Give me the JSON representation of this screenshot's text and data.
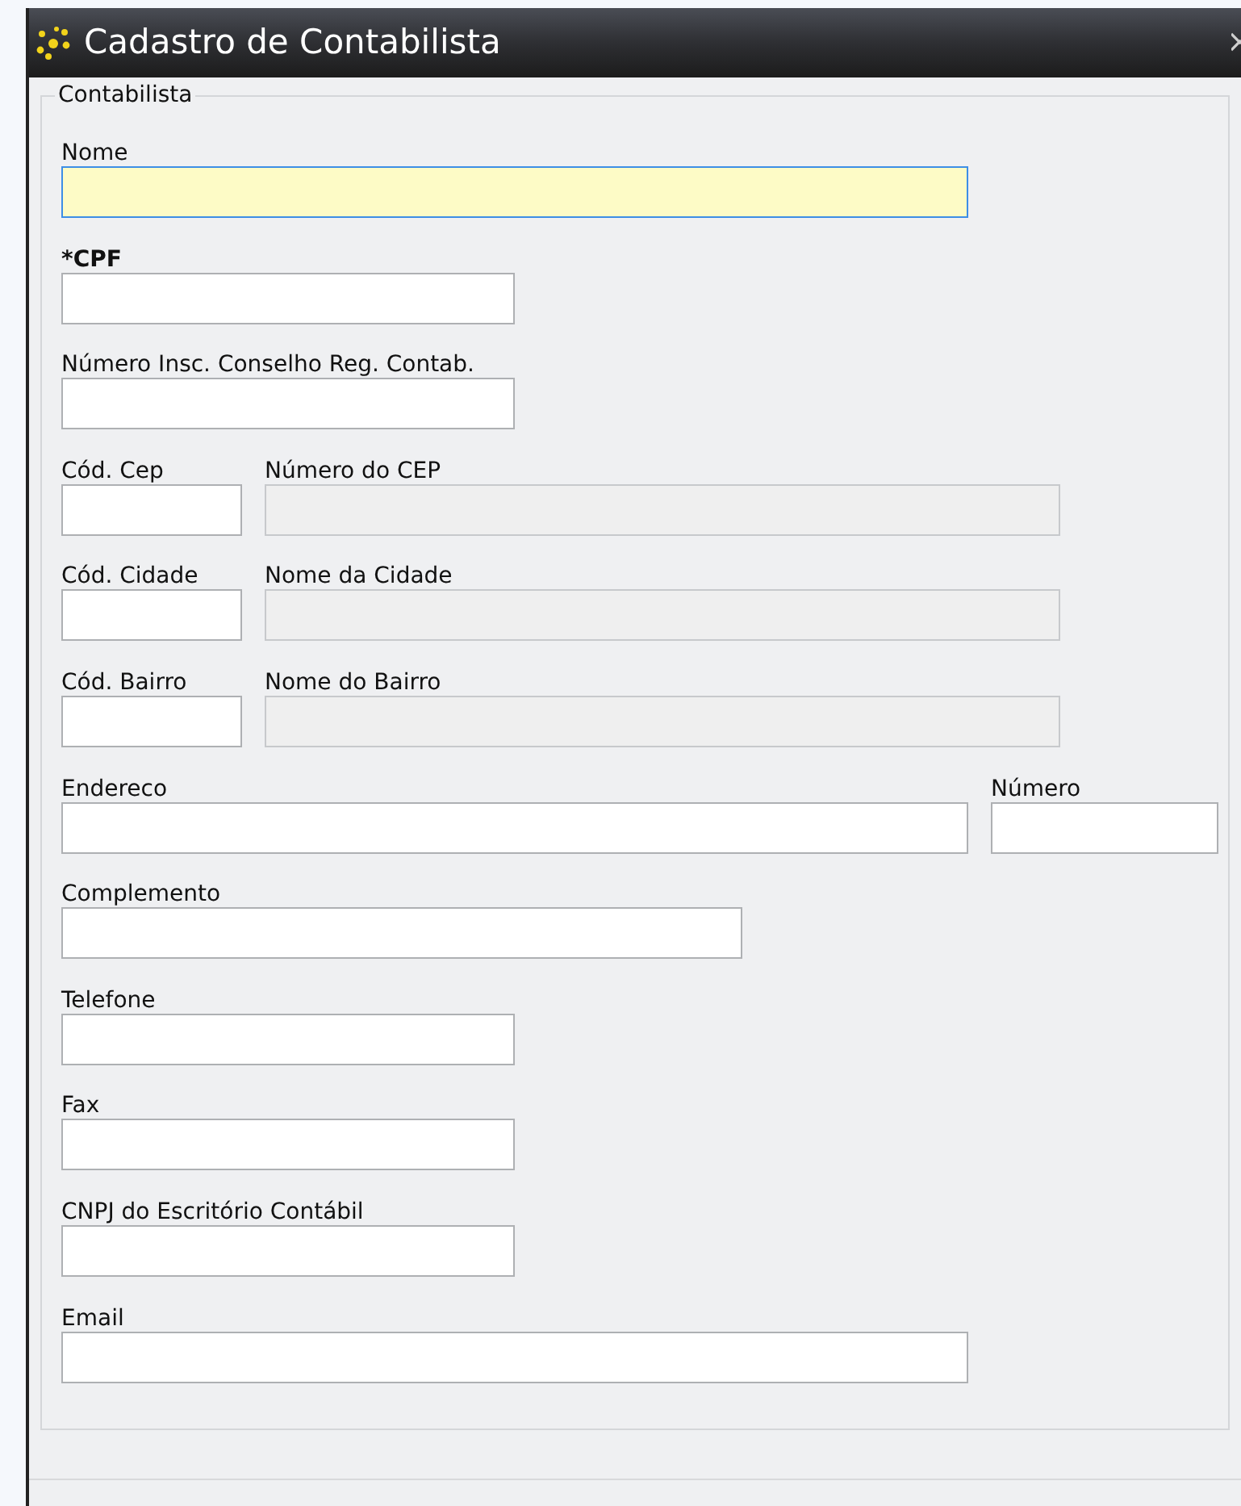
{
  "window": {
    "title": "Cadastro de Contabilista"
  },
  "group": {
    "title": "Contabilista",
    "rows": [
      [
        {
          "label": "Nome",
          "required": false,
          "focused": true,
          "disabled": false
        }
      ],
      [
        {
          "label": "*CPF",
          "required": true,
          "focused": false,
          "disabled": false
        }
      ],
      [
        {
          "label": "Número Insc. Conselho Reg. Contab.",
          "required": false,
          "focused": false,
          "disabled": false
        }
      ],
      [
        {
          "label": "Cód. Cep",
          "required": false,
          "focused": false,
          "disabled": false
        },
        {
          "label": "Número do CEP",
          "required": false,
          "focused": false,
          "disabled": true
        }
      ],
      [
        {
          "label": "Cód. Cidade",
          "required": false,
          "focused": false,
          "disabled": false
        },
        {
          "label": "Nome da Cidade",
          "required": false,
          "focused": false,
          "disabled": true
        }
      ],
      [
        {
          "label": "Cód. Bairro",
          "required": false,
          "focused": false,
          "disabled": false
        },
        {
          "label": "Nome do Bairro",
          "required": false,
          "focused": false,
          "disabled": true
        }
      ],
      [
        {
          "label": "Endereco",
          "required": false,
          "focused": false,
          "disabled": false
        },
        {
          "label": "Número",
          "required": false,
          "focused": false,
          "disabled": false
        }
      ],
      [
        {
          "label": "Complemento",
          "required": false,
          "focused": false,
          "disabled": false
        }
      ],
      [
        {
          "label": "Telefone",
          "required": false,
          "focused": false,
          "disabled": false
        }
      ],
      [
        {
          "label": "Fax",
          "required": false,
          "focused": false,
          "disabled": false
        }
      ],
      [
        {
          "label": "CNPJ do Escritório Contábil",
          "required": false,
          "focused": false,
          "disabled": false
        }
      ],
      [
        {
          "label": "Email",
          "required": false,
          "focused": false,
          "disabled": false
        }
      ]
    ]
  }
}
